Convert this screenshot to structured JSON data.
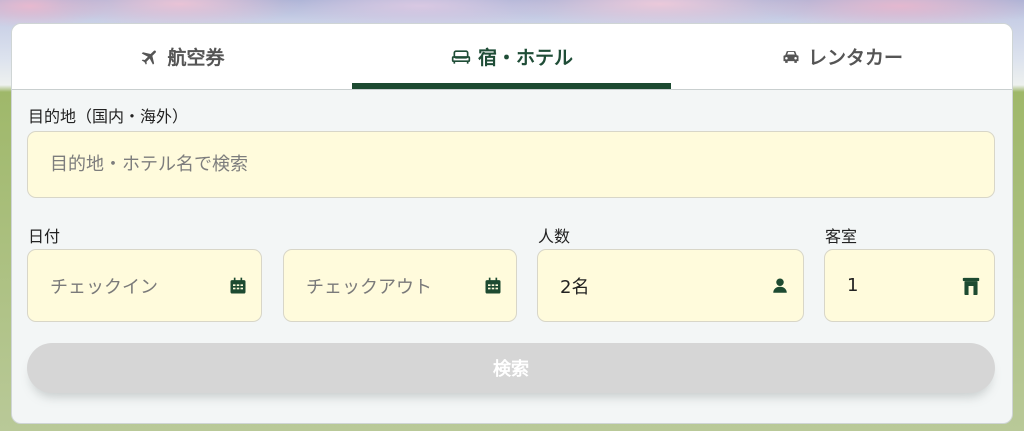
{
  "tabs": [
    {
      "label": "航空券",
      "icon": "airplane-icon",
      "active": false
    },
    {
      "label": "宿・ホテル",
      "icon": "bed-icon",
      "active": true
    },
    {
      "label": "レンタカー",
      "icon": "car-icon",
      "active": false
    }
  ],
  "destination": {
    "label": "目的地（国内・海外）",
    "placeholder": "目的地・ホテル名で検索"
  },
  "date": {
    "label": "日付",
    "checkin_placeholder": "チェックイン",
    "checkout_placeholder": "チェックアウト",
    "icon": "calendar-icon"
  },
  "guests": {
    "label": "人数",
    "value": "2名",
    "icon": "person-icon"
  },
  "rooms": {
    "label": "客室",
    "value": "1",
    "icon": "door-icon"
  },
  "search_button": {
    "label": "検索"
  },
  "colors": {
    "accent": "#1d4a31",
    "field_bg": "#fffbdc",
    "button_disabled": "#d6d6d6"
  }
}
